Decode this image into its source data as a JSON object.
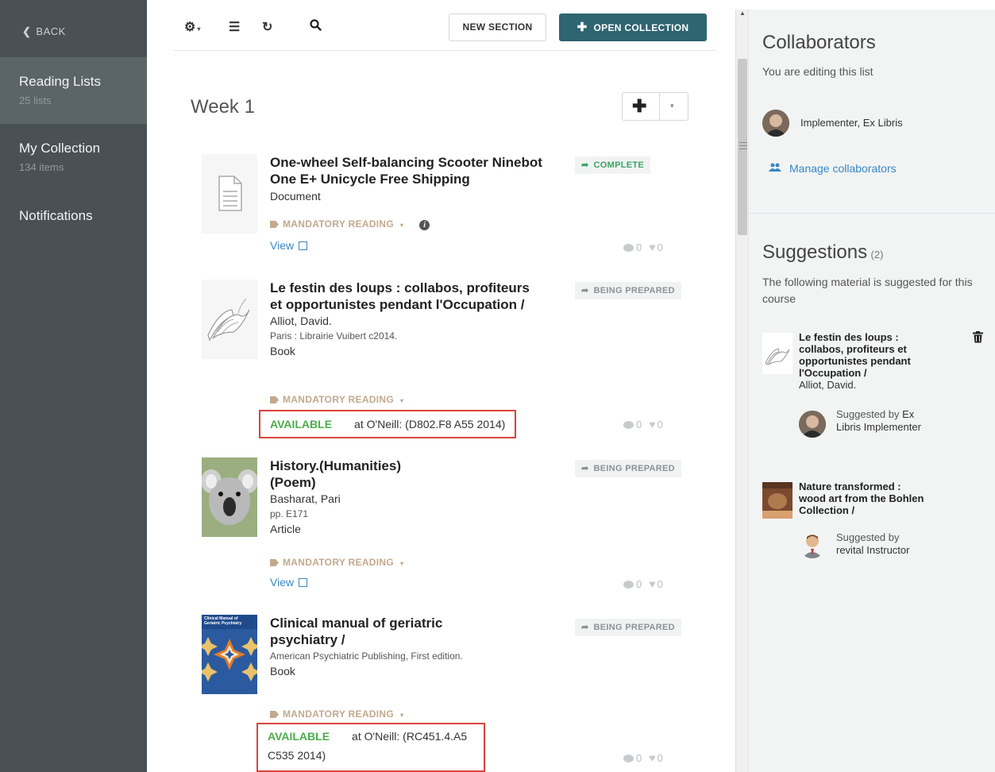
{
  "sidebar": {
    "back_label": "BACK",
    "items": [
      {
        "label": "Reading Lists",
        "sub": "25 lists"
      },
      {
        "label": "My Collection",
        "sub": "134 items"
      },
      {
        "label": "Notifications",
        "sub": ""
      }
    ]
  },
  "toolbar": {
    "new_section_label": "NEW SECTION",
    "open_collection_label": "OPEN COLLECTION"
  },
  "section": {
    "title": "Week 1"
  },
  "items": [
    {
      "title": "One-wheel Self-balancing Scooter Ninebot One E+ Unicycle Free Shipping",
      "type": "Document",
      "tag": "MANDATORY READING",
      "status": "COMPLETE",
      "view_label": "View",
      "comments": "0",
      "likes": "0"
    },
    {
      "title": "Le festin des loups : collabos, profiteurs et opportunistes pendant l'Occupation /",
      "author": "Alliot, David.",
      "publication": "Paris : Librairie Vuibert c2014.",
      "type": "Book",
      "tag": "MANDATORY READING",
      "status": "BEING PREPARED",
      "availability": "AVAILABLE",
      "location": "at O'Neill: (D802.F8 A55 2014)",
      "comments": "0",
      "likes": "0"
    },
    {
      "title": "History.(Humanities) (Poem)",
      "author": "Basharat, Pari",
      "publication": "pp. E171",
      "type": "Article",
      "tag": "MANDATORY READING",
      "status": "BEING PREPARED",
      "view_label": "View",
      "comments": "0",
      "likes": "0"
    },
    {
      "title": "Clinical manual of geriatric psychiatry /",
      "publication": "American Psychiatric Publishing, First edition.",
      "type": "Book",
      "tag": "MANDATORY READING",
      "status": "BEING PREPARED",
      "availability": "AVAILABLE",
      "location_line1": "at O'Neill: (RC451.4.A5",
      "location_line2": "C535 2014)",
      "comments": "0",
      "likes": "0",
      "cover_title": "Clinical Manual of Geriatric Psychiatry"
    }
  ],
  "collaborators": {
    "heading": "Collaborators",
    "editing_note": "You are editing this list",
    "people": [
      {
        "name": "Implementer, Ex Libris"
      }
    ],
    "manage_label": "Manage collaborators"
  },
  "suggestions": {
    "heading": "Suggestions",
    "count": "(2)",
    "intro": "The following material is suggested for this course",
    "items": [
      {
        "title": "Le festin des loups : collabos, profiteurs et opportunistes pendant l'Occupation /",
        "author": "Alliot, David.",
        "suggested_by_prefix": "Suggested by",
        "suggested_by": "Ex Libris Implementer"
      },
      {
        "title": "Nature transformed : wood art from the Bohlen Collection /",
        "suggested_by_prefix": "Suggested by",
        "suggested_by": "revital Instructor"
      }
    ]
  },
  "colors": {
    "sidebar_bg": "#4a5154",
    "primary_button": "#2f6471",
    "link": "#3a87c4",
    "available": "#4cae4c",
    "tag": "#c2a98d",
    "highlight_box": "#d9433b"
  }
}
